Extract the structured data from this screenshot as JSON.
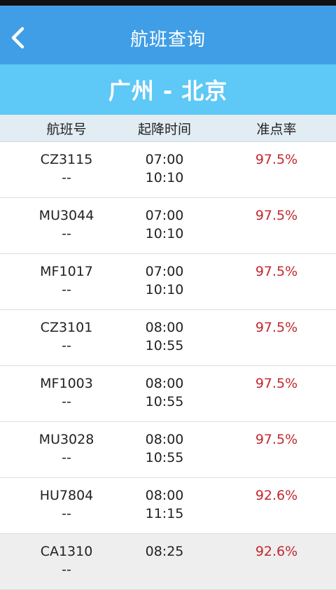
{
  "header": {
    "title": "航班查询",
    "back_icon": "chevron-left-icon"
  },
  "route": {
    "text": "广州 - 北京"
  },
  "columns": {
    "flight": "航班号",
    "times": "起降时间",
    "rate": "准点率"
  },
  "colors": {
    "header_bg": "#3f9ee6",
    "route_bg": "#5ec8f6",
    "rate_text": "#c0282e"
  },
  "flights": [
    {
      "flight_no": "CZ3115",
      "sub": "--",
      "depart": "07:00",
      "arrive": "10:10",
      "rate": "97.5%"
    },
    {
      "flight_no": "MU3044",
      "sub": "--",
      "depart": "07:00",
      "arrive": "10:10",
      "rate": "97.5%"
    },
    {
      "flight_no": "MF1017",
      "sub": "--",
      "depart": "07:00",
      "arrive": "10:10",
      "rate": "97.5%"
    },
    {
      "flight_no": "CZ3101",
      "sub": "--",
      "depart": "08:00",
      "arrive": "10:55",
      "rate": "97.5%"
    },
    {
      "flight_no": "MF1003",
      "sub": "--",
      "depart": "08:00",
      "arrive": "10:55",
      "rate": "97.5%"
    },
    {
      "flight_no": "MU3028",
      "sub": "--",
      "depart": "08:00",
      "arrive": "10:55",
      "rate": "97.5%"
    },
    {
      "flight_no": "HU7804",
      "sub": "--",
      "depart": "08:00",
      "arrive": "11:15",
      "rate": "92.6%"
    },
    {
      "flight_no": "CA1310",
      "sub": "--",
      "depart": "08:25",
      "arrive": "",
      "rate": "92.6%"
    }
  ]
}
